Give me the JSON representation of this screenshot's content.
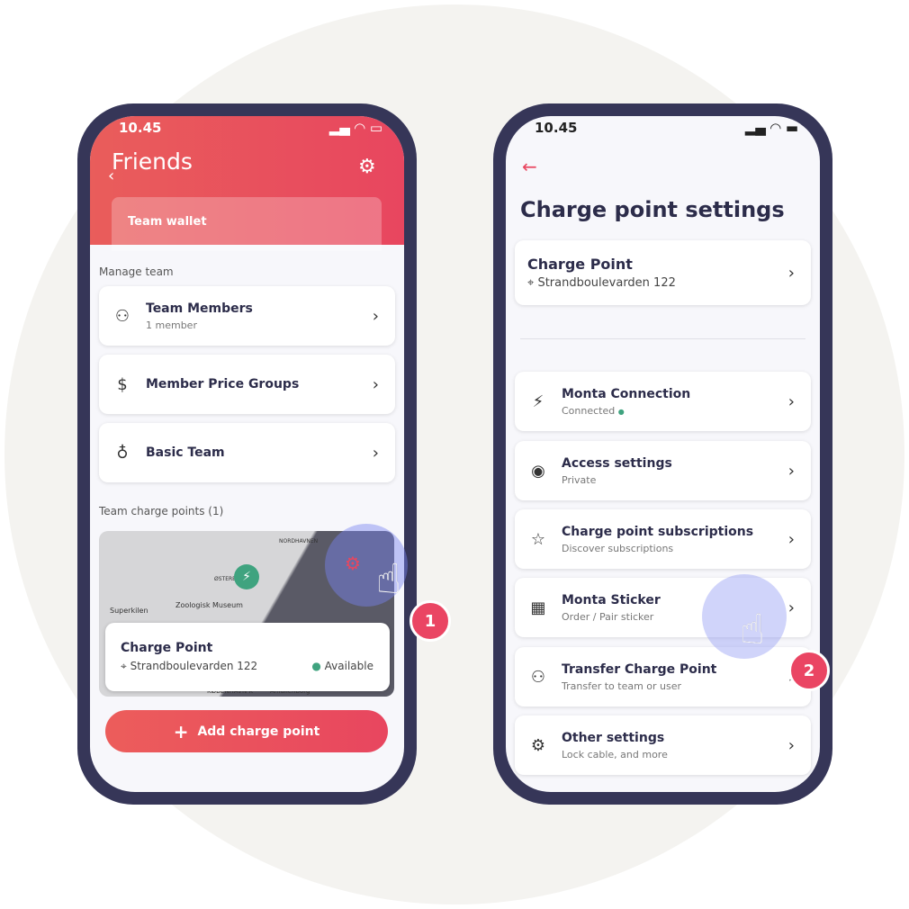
{
  "left": {
    "time": "10.45",
    "title": "Friends",
    "wallet": "Team wallet",
    "manage_label": "Manage team",
    "items": [
      {
        "title": "Team Members",
        "sub": "1 member",
        "icon": "users-icon"
      },
      {
        "title": "Member Price Groups",
        "icon": "dollar-icon"
      },
      {
        "title": "Basic Team",
        "icon": "award-icon"
      }
    ],
    "cp_label": "Team charge points (1)",
    "map": {
      "labels": [
        "NORDHAVNEN",
        "ØSTERBRO",
        "Zoologisk Museum",
        "Superkilen",
        "KØBENHAVN K",
        "Amalienborg"
      ]
    },
    "cp": {
      "title": "Charge Point",
      "address": "Strandboulevarden 122",
      "status": "Available",
      "status_color": "#3fa37f"
    },
    "add_button": "Add charge point",
    "step": "1"
  },
  "right": {
    "time": "10.45",
    "title": "Charge point settings",
    "cp": {
      "title": "Charge Point",
      "address": "Strandboulevarden 122"
    },
    "items": [
      {
        "title": "Monta Connection",
        "sub": "Connected",
        "icon": "charger-icon"
      },
      {
        "title": "Access settings",
        "sub": "Private",
        "icon": "eye-icon"
      },
      {
        "title": "Charge point subscriptions",
        "sub": "Discover subscriptions",
        "icon": "star-icon"
      },
      {
        "title": "Monta Sticker",
        "sub": "Order / Pair sticker",
        "icon": "qr-icon"
      },
      {
        "title": "Transfer Charge Point",
        "sub": "Transfer to team or user",
        "icon": "users-icon"
      },
      {
        "title": "Other settings",
        "sub": "Lock cable, and more",
        "icon": "gear-icon"
      }
    ],
    "step": "2"
  },
  "colors": {
    "accent": "#ea4563",
    "frame": "#363658"
  }
}
